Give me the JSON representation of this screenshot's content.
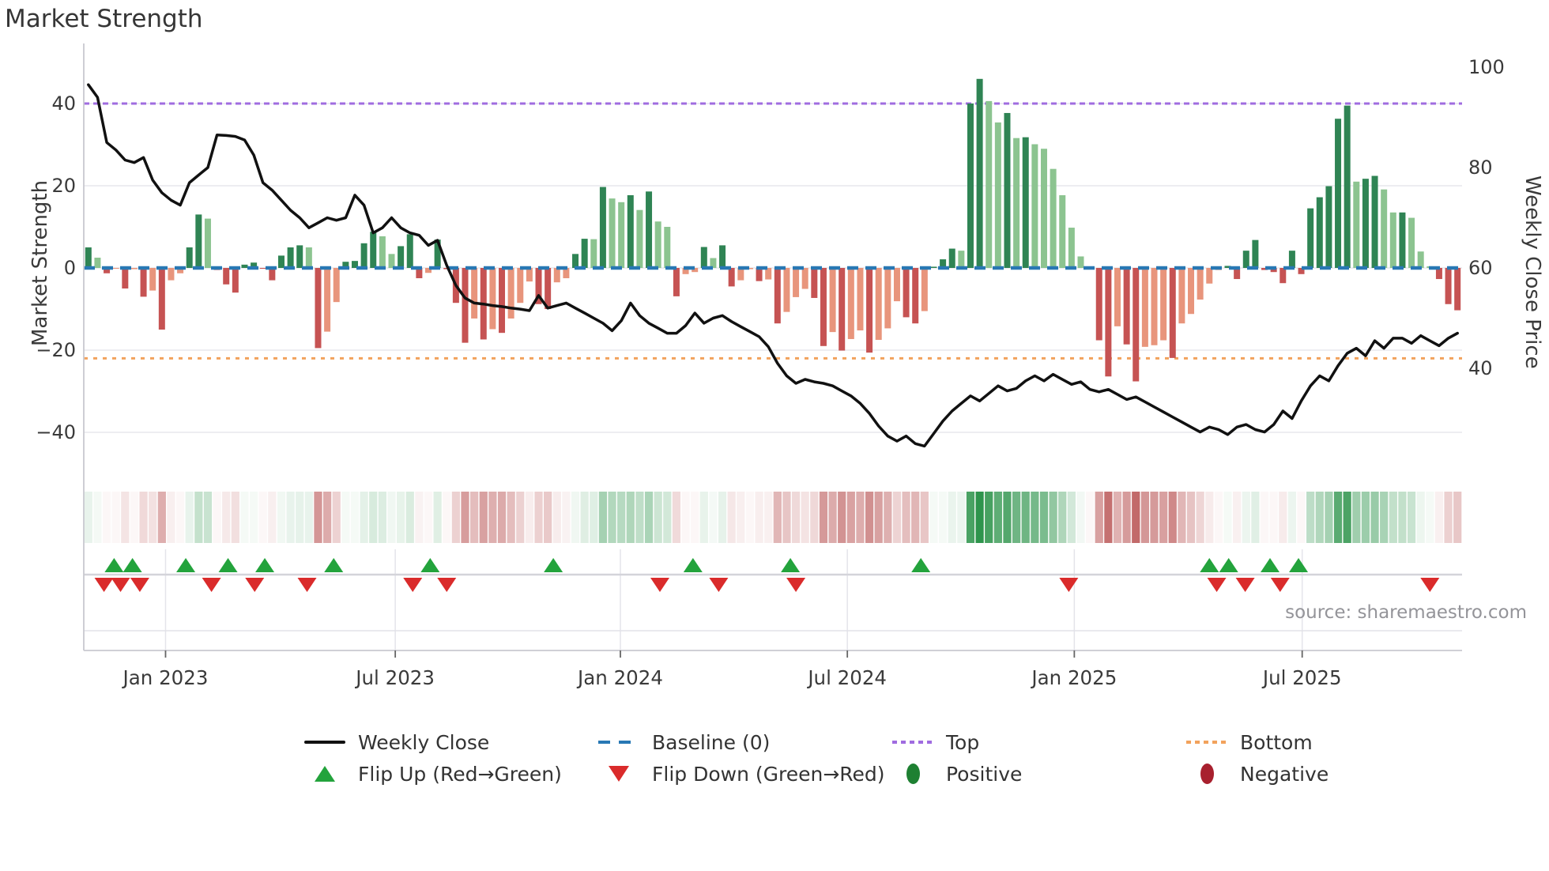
{
  "title": "Market Strength",
  "source": "source: sharemaestro.com",
  "axes": {
    "left_label": "Market Strength",
    "right_label": "Weekly Close Price",
    "left_ticks": [
      {
        "label": "40",
        "value": 40
      },
      {
        "label": "20",
        "value": 20
      },
      {
        "label": "0",
        "value": 0
      },
      {
        "label": "−20",
        "value": -20
      },
      {
        "label": "−40",
        "value": -40
      }
    ],
    "right_ticks": [
      {
        "label": "100",
        "value": 100
      },
      {
        "label": "80",
        "value": 80
      },
      {
        "label": "60",
        "value": 60
      },
      {
        "label": "40",
        "value": 40
      }
    ],
    "x_ticks": [
      {
        "label": "Jan 2023",
        "week": 8.4
      },
      {
        "label": "Jul 2023",
        "week": 33.4
      },
      {
        "label": "Jan 2024",
        "week": 57.9
      },
      {
        "label": "Jul 2024",
        "week": 82.6
      },
      {
        "label": "Jan 2025",
        "week": 107.3
      },
      {
        "label": "Jul 2025",
        "week": 132.1
      }
    ]
  },
  "legend": {
    "weekly_close": "Weekly Close",
    "baseline": "Baseline (0)",
    "top": "Top",
    "bottom": "Bottom",
    "flip_up": "Flip Up (Red→Green)",
    "flip_down": "Flip Down (Green→Red)",
    "positive": "Positive",
    "negative": "Negative"
  },
  "colors": {
    "bar_pos_strong": "#2f8454",
    "bar_pos_light": "#8cc490",
    "bar_neg_strong": "#c65353",
    "bar_neg_light": "#e8957c",
    "line": "#111111",
    "baseline": "#2878b4",
    "top": "#a06ce0",
    "bottom": "#f2a25c",
    "flip_up": "#23a33c",
    "flip_down": "#da2b2b",
    "heat_pos_base": "#2e944c",
    "heat_neg_base": "#c16868",
    "grid": "#ededf1",
    "spine": "#c9c9d0",
    "tick_text": "#3a3a3a"
  },
  "chart_data": {
    "type": "bar",
    "title": "Market Strength",
    "ylabel_left": "Market Strength",
    "ylabel_right": "Weekly Close Price",
    "left_ylim": [
      -50,
      48
    ],
    "right_ylim": [
      38,
      103
    ],
    "baseline_value": 0,
    "top_value": 40,
    "bottom_value": -22,
    "x_range": "weekly, Nov 2022 - Sep 2025",
    "series": [
      {
        "name": "Market Strength",
        "type": "bar",
        "axis": "left",
        "values": [
          5,
          2.5,
          -1.3,
          -0.2,
          -5,
          -0.3,
          -7,
          -5.5,
          -15,
          -3,
          -1.3,
          5,
          13,
          12,
          -0.5,
          -4,
          -6,
          0.8,
          1.3,
          -0.2,
          -3,
          3,
          5,
          5.5,
          5,
          -19.5,
          -15.5,
          -8.3,
          1.5,
          1.7,
          6,
          8.8,
          7.7,
          3.4,
          5.3,
          8.2,
          -2.5,
          -1.2,
          6.9,
          -0.3,
          -8.5,
          -18.2,
          -12.3,
          -17.4,
          -14.9,
          -15.8,
          -12.3,
          -8.5,
          -3.3,
          -8.8,
          -10,
          -3.5,
          -2.5,
          3.4,
          7.1,
          7.0,
          19.7,
          16.9,
          16.0,
          17.7,
          14.1,
          18.6,
          11.3,
          10.0,
          -6.9,
          -1.5,
          -1.0,
          5.1,
          2.4,
          5.5,
          -4.5,
          -3,
          -0.3,
          -3.2,
          -2.8,
          -13.5,
          -10.7,
          -7.1,
          -5.1,
          -7.3,
          -19,
          -15.6,
          -20.1,
          -17.3,
          -15.2,
          -20.6,
          -17.5,
          -14.7,
          -8.1,
          -12,
          -13.5,
          -10.5,
          0.3,
          2.1,
          4.7,
          4.2,
          40,
          46,
          40.6,
          35.4,
          37.7,
          31.6,
          31.8,
          30.1,
          29,
          24.1,
          17.7,
          9.8,
          2.8,
          -0.3,
          -17.6,
          -26.4,
          -14.2,
          -18.6,
          -27.6,
          -19.2,
          -18.8,
          -17.6,
          -21.9,
          -13.5,
          -11.2,
          -7.7,
          -3.8,
          -0.5,
          0.5,
          -2.7,
          4.2,
          6.8,
          -0.5,
          -1.0,
          -3.7,
          4.2,
          -1.5,
          14.5,
          17.2,
          19.9,
          36.3,
          39.5,
          21,
          21.7,
          22.4,
          19.1,
          13.5,
          13.5,
          12.2,
          4,
          0.4,
          -2.7,
          -8.8,
          -10.3
        ]
      },
      {
        "name": "Weekly Close",
        "type": "line",
        "axis": "right",
        "values": [
          96.5,
          94,
          85,
          83.5,
          81.5,
          81,
          82,
          77.5,
          75,
          73.5,
          72.5,
          77,
          78.5,
          80,
          86.5,
          86.4,
          86.2,
          85.5,
          82.5,
          77,
          75.5,
          73.5,
          71.5,
          70,
          68,
          69,
          70,
          69.5,
          70,
          74.5,
          72.5,
          67,
          68,
          70,
          68,
          67,
          66.5,
          64.5,
          65.5,
          60.5,
          56.5,
          54,
          53,
          52.8,
          52.5,
          52.3,
          52,
          51.8,
          51.5,
          54.5,
          52,
          52.5,
          53,
          52,
          51,
          50,
          49,
          47.5,
          49.5,
          53,
          50.5,
          49,
          48,
          47,
          47,
          48.5,
          51,
          49,
          50,
          50.5,
          49.3,
          48.3,
          47.3,
          46.3,
          44.3,
          41,
          38.5,
          37,
          37.8,
          37.3,
          37,
          36.5,
          35.5,
          34.5,
          33,
          31,
          28.5,
          26.5,
          25.5,
          26.5,
          25,
          24.5,
          27,
          29.5,
          31.5,
          33,
          34.5,
          33.5,
          35,
          36.5,
          35.5,
          36,
          37.5,
          38.5,
          37.5,
          38.8,
          37.8,
          36.8,
          37.3,
          35.8,
          35.3,
          35.8,
          34.8,
          33.8,
          34.3,
          33.3,
          32.3,
          31.3,
          30.3,
          29.3,
          28.3,
          27.3,
          28.3,
          27.8,
          26.8,
          28.3,
          28.8,
          27.8,
          27.3,
          28.8,
          31.5,
          30,
          33.5,
          36.5,
          38.5,
          37.5,
          40.5,
          43,
          44,
          42.5,
          45.5,
          44,
          46,
          46,
          45,
          46.5,
          45.5,
          44.5,
          46,
          47
        ]
      }
    ],
    "heatmap": "one cell per week; color intensity proportional to Market Strength value (green positive, red negative)",
    "flip_up_weeks": [
      2.8,
      4.8,
      10.6,
      15.2,
      19.2,
      26.7,
      37.2,
      50.6,
      65.8,
      76.4,
      90.6,
      122.0,
      124.1,
      128.6,
      131.7
    ],
    "flip_down_weeks": [
      1.7,
      3.5,
      5.6,
      13.4,
      18.1,
      23.8,
      35.3,
      39.0,
      62.2,
      68.6,
      77.0,
      106.7,
      122.8,
      125.9,
      129.7,
      146.0
    ],
    "legend_position": "bottom",
    "grid": true
  }
}
